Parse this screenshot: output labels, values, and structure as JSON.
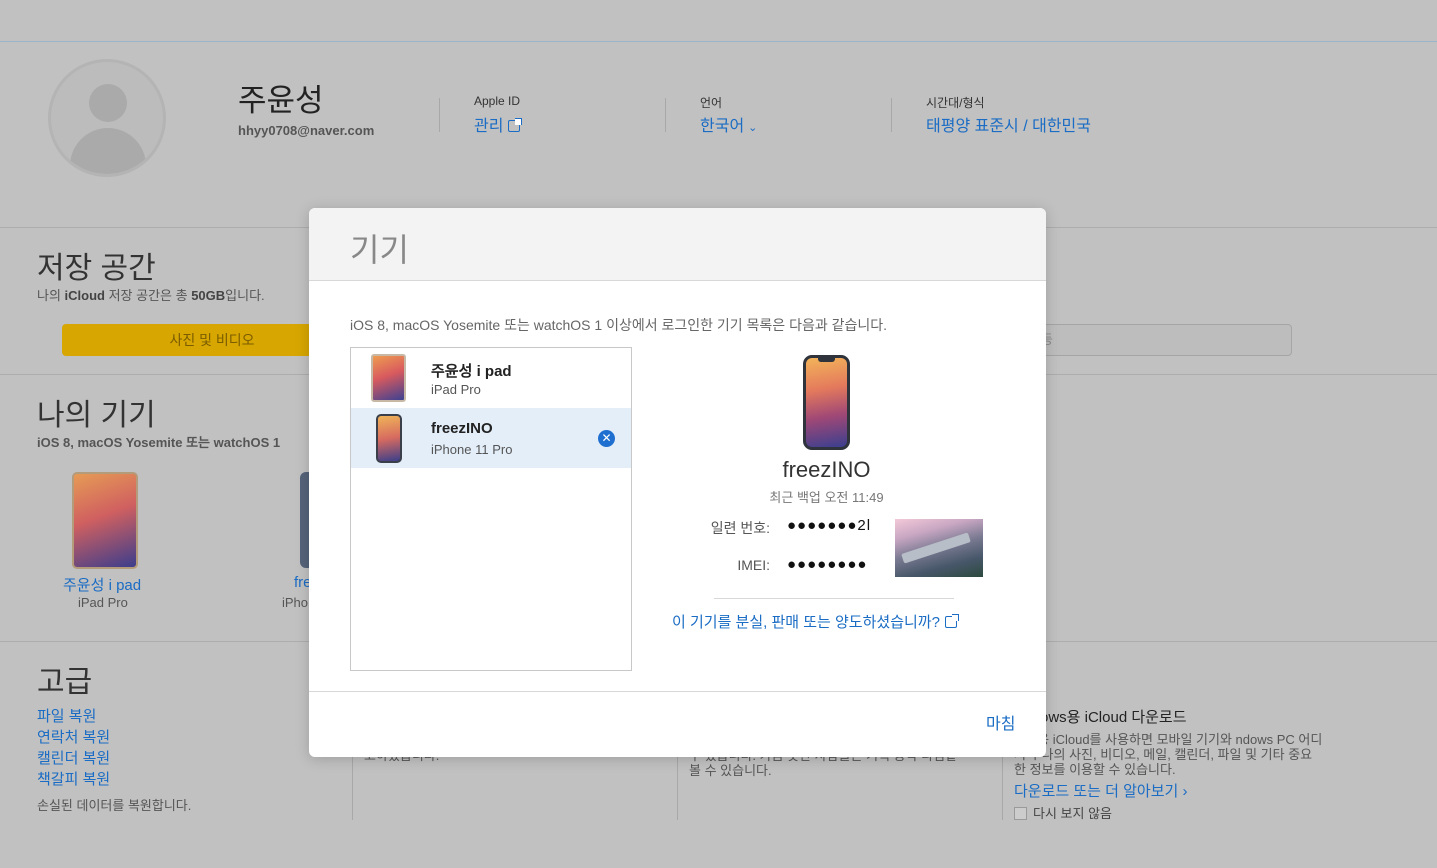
{
  "profile": {
    "name": "주윤성",
    "email": "hhyy0708@naver.com",
    "apple_id_label": "Apple ID",
    "apple_id_value": "관리",
    "language_label": "언어",
    "language_value": "한국어",
    "timezone_label": "시간대/형식",
    "timezone_value": "태평양 표준시 / 대한민국"
  },
  "storage": {
    "title": "저장 공간",
    "sub_prefix": "나의 ",
    "sub_brand": "iCloud",
    "sub_middle": " 저장 공간은 총 ",
    "sub_amount": "50GB",
    "sub_suffix": "입니다.",
    "bar_label": "사진 및 비디오",
    "bar_right_fragment": "등",
    "photos_fraction": 0.24
  },
  "my_devices": {
    "title": "나의 기기",
    "subtitle": "iOS 8, macOS Yosemite 또는 watchOS 1",
    "items": [
      {
        "name": "주윤성 i pad",
        "model": "iPad Pro"
      },
      {
        "name": "fre",
        "model": "iPho"
      }
    ]
  },
  "advanced": {
    "title": "고급",
    "links": [
      "파일 복원",
      "연락처 복원",
      "캘린더 복원",
      "책갈피 복원"
    ],
    "note": "손실된 데이터를 복원합니다.",
    "mid_text_1": "고하였습니다.",
    "mid_text_2_line1": "수 있습니다. 가끔 듯한 사람들은 기획 동작 나님같",
    "mid_text_2_line2": "볼 수 있습니다."
  },
  "windows": {
    "title": "ows용 iCloud 다운로드",
    "desc": "ows용 iCloud를 사용하면 모바일 기기와 ndows PC 어디서나 나의 사진, 비디오, 메일, 캘린더, 파일 및 기타 중요한 정보를 이용할 수 있습니다.",
    "link": "다운로드 또는 더 알아보기",
    "checkbox": "다시 보지 않음"
  },
  "modal": {
    "title": "기기",
    "description": "iOS 8, macOS Yosemite 또는 watchOS 1 이상에서 로그인한 기기 목록은 다음과 같습니다.",
    "devices": [
      {
        "name": "주윤성 i pad",
        "model": "iPad Pro",
        "selected": false
      },
      {
        "name": "freezINO",
        "model": "iPhone 11 Pro",
        "selected": true
      }
    ],
    "detail": {
      "name": "freezINO",
      "backup": "최근 백업 오전 11:49",
      "serial_label": "일련 번호:",
      "serial_value": "●●●●●●●2l",
      "imei_label": "IMEI:",
      "imei_value": "●●●●●●●●",
      "lost_link": "이 기기를 분실, 판매 또는 양도하셨습니까?"
    },
    "done_label": "마침"
  },
  "colors": {
    "link_blue": "#1a6cc4",
    "storage_yellow": "#d7a600",
    "remove_blue": "#1f6fd0"
  }
}
